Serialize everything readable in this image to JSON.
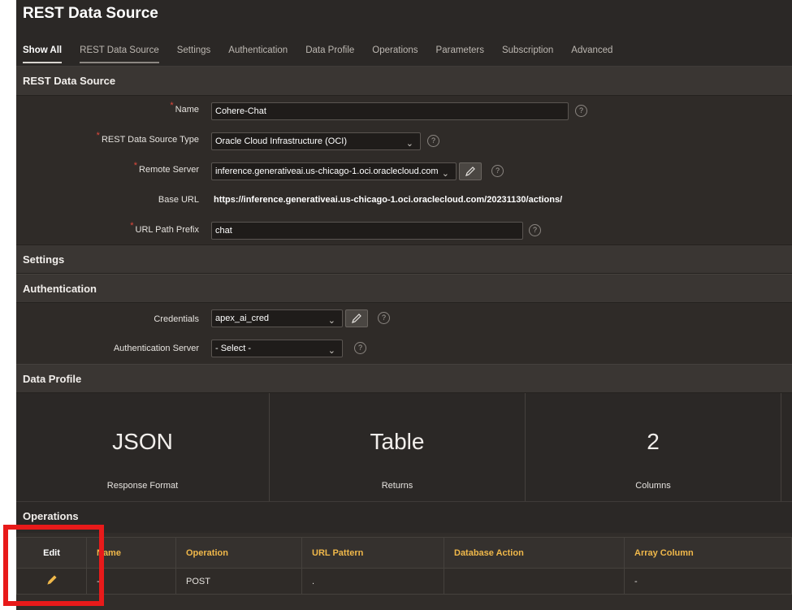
{
  "header": {
    "title": "REST Data Source",
    "tabs": [
      "Show All",
      "REST Data Source",
      "Settings",
      "Authentication",
      "Data Profile",
      "Operations",
      "Parameters",
      "Subscription",
      "Advanced"
    ]
  },
  "rest_data_source": {
    "section_title": "REST Data Source",
    "name_label": "Name",
    "name_value": "Cohere-Chat",
    "type_label": "REST Data Source Type",
    "type_value": "Oracle Cloud Infrastructure (OCI)",
    "server_label": "Remote Server",
    "server_value": "inference.generativeai.us-chicago-1.oci.oraclecloud.com",
    "base_url_label": "Base URL",
    "base_url_value": "https://inference.generativeai.us-chicago-1.oci.oraclecloud.com/20231130/actions/",
    "prefix_label": "URL Path Prefix",
    "prefix_value": "chat",
    "required_mark": "*",
    "help_glyph": "?"
  },
  "settings": {
    "section_title": "Settings"
  },
  "authentication": {
    "section_title": "Authentication",
    "credentials_label": "Credentials",
    "credentials_value": "apex_ai_cred",
    "auth_server_label": "Authentication Server",
    "auth_server_value": "- Select -"
  },
  "data_profile": {
    "section_title": "Data Profile",
    "cards": [
      {
        "value": "JSON",
        "label": "Response Format"
      },
      {
        "value": "Table",
        "label": "Returns"
      },
      {
        "value": "2",
        "label": "Columns"
      }
    ]
  },
  "operations": {
    "section_title": "Operations",
    "columns": [
      "Edit",
      "Name",
      "Operation",
      "URL Pattern",
      "Database Action",
      "Array Column"
    ],
    "rows": [
      {
        "name": "-",
        "operation": "POST",
        "url_pattern": ".",
        "database_action": "",
        "array_column": "-"
      }
    ]
  },
  "icons": {
    "pencil": "pencil-icon",
    "chevron": "chevron-down-icon",
    "help": "help-icon"
  },
  "colors": {
    "accent": "#f0b84a",
    "required": "#e0483c",
    "highlight_box": "#e81a1a",
    "background": "#312d2a"
  }
}
